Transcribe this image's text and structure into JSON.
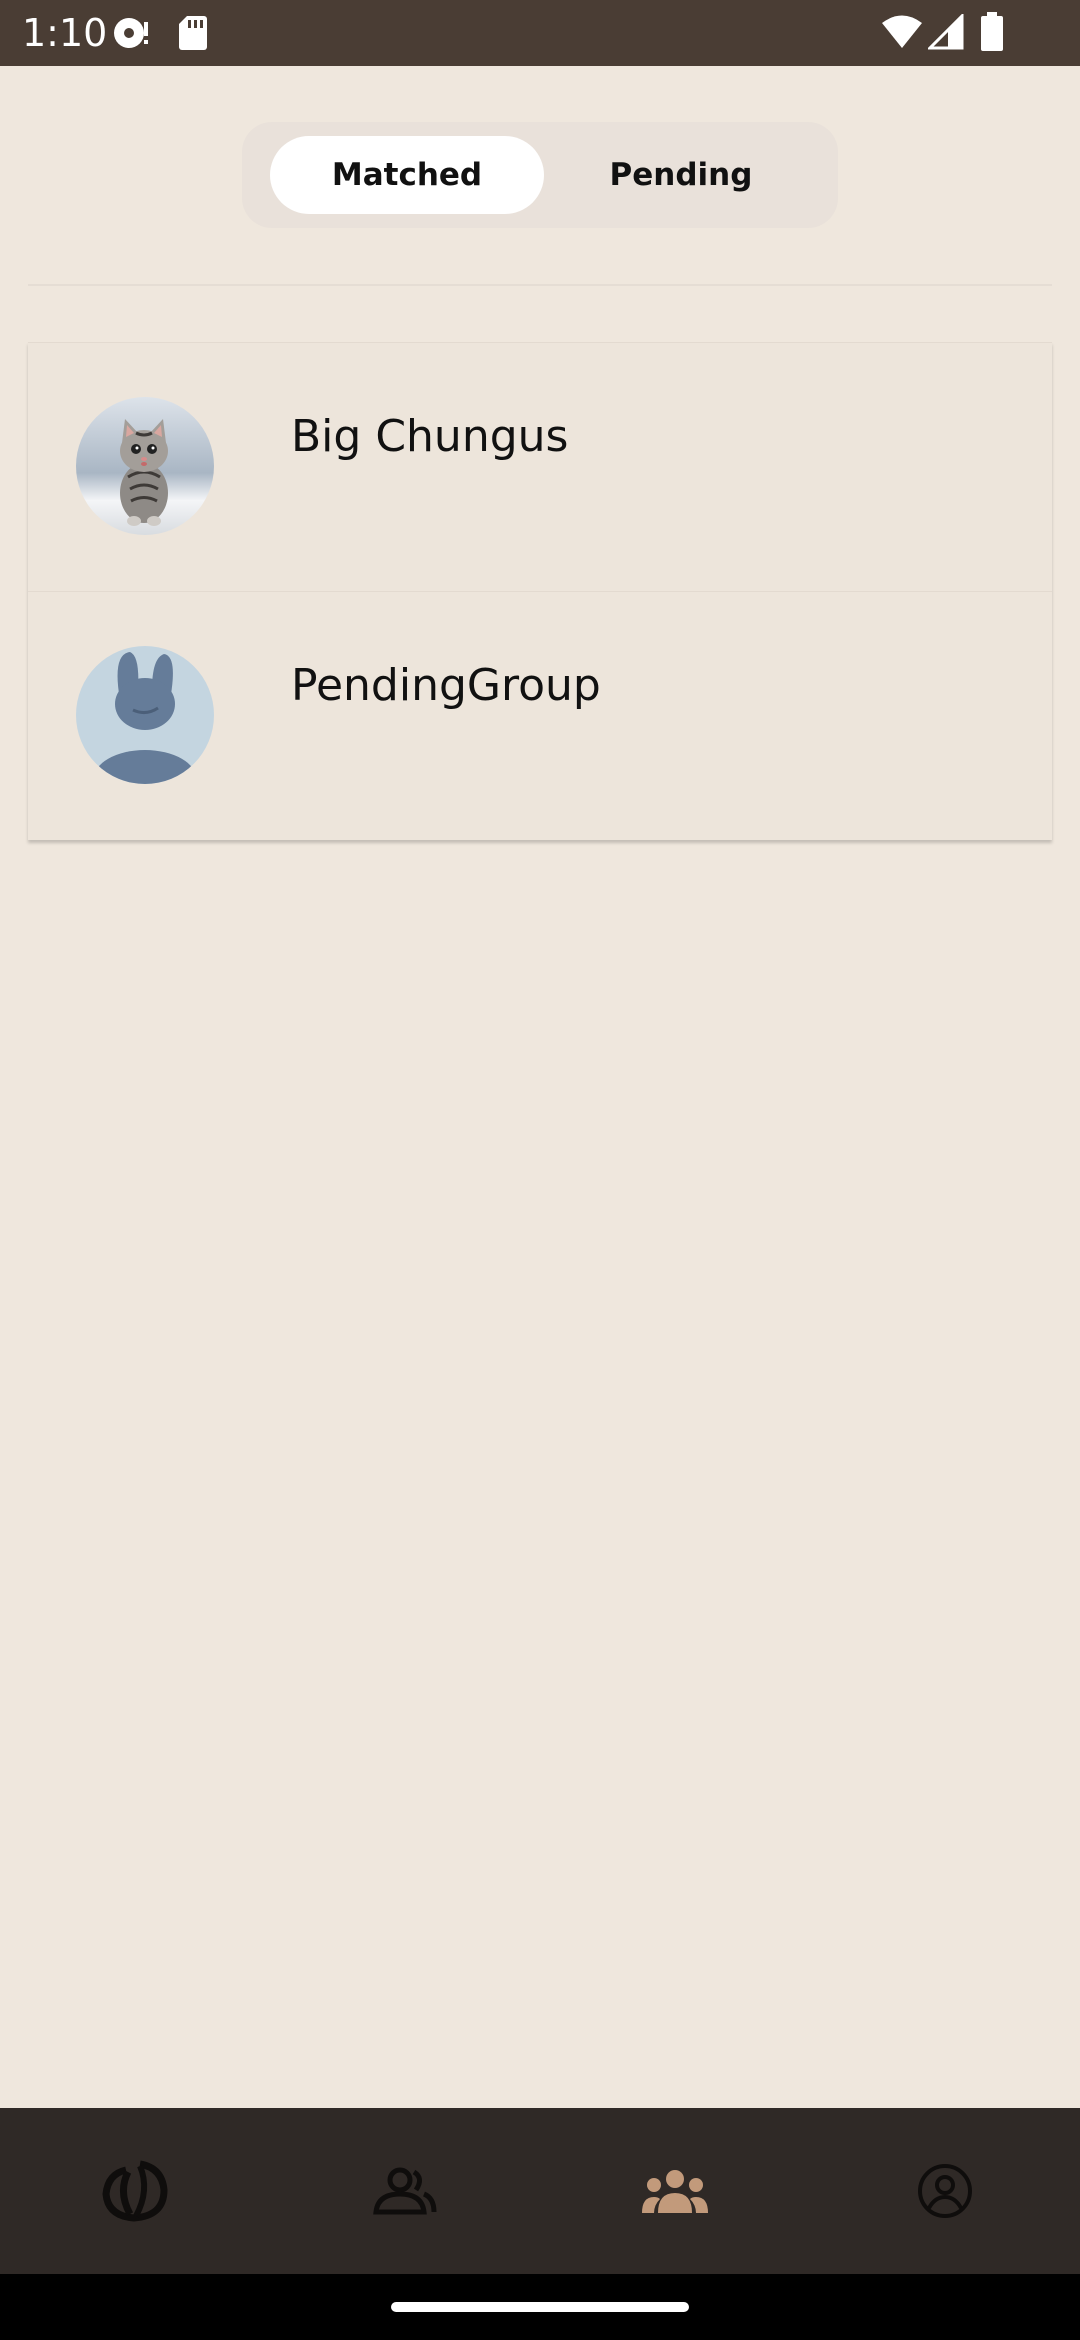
{
  "status_bar": {
    "time": "1:10",
    "icons": [
      "media-icon",
      "sd-card-icon",
      "wifi-icon",
      "signal-icon",
      "battery-icon"
    ]
  },
  "tabs": {
    "matched_label": "Matched",
    "pending_label": "Pending",
    "selected": "Matched"
  },
  "groups": [
    {
      "name": "Big Chungus",
      "avatar": "kitten-photo"
    },
    {
      "name": "PendingGroup",
      "avatar": "default-bunny-avatar"
    }
  ],
  "bottom_nav": {
    "items": [
      "home-logo-icon",
      "person-icon",
      "group-icon",
      "account-icon"
    ],
    "active": "group-icon"
  },
  "colors": {
    "background": "#EFE7DD",
    "status_bar": "#4A3D34",
    "nav_bar": "#2F2926",
    "accent": "#C29A7B"
  }
}
